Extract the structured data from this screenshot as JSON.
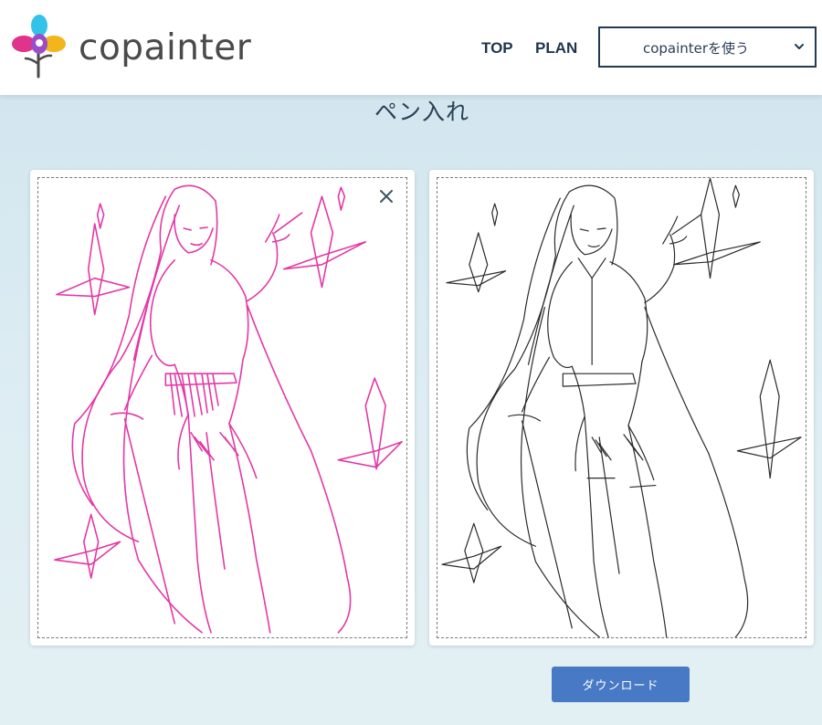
{
  "brand": {
    "name": "copainter",
    "logo_icon": "flower-logo-icon",
    "colors": {
      "cyan": "#33c3e8",
      "magenta": "#e0338a",
      "yellow": "#f3b51c",
      "purple": "#9b4dc9"
    }
  },
  "nav": {
    "top_label": "TOP",
    "plan_label": "PLAN",
    "use_select": {
      "label": "copainterを使う",
      "icon": "chevron-down-icon"
    }
  },
  "page": {
    "title": "ペン入れ"
  },
  "images": {
    "input": {
      "kind": "rough-sketch",
      "stroke_color": "#e0229b",
      "close_icon": "close-icon"
    },
    "output": {
      "kind": "clean-lineart",
      "stroke_color": "#2a2a2a"
    }
  },
  "actions": {
    "download_label": "ダウンロード",
    "download_color": "#4779c4"
  }
}
